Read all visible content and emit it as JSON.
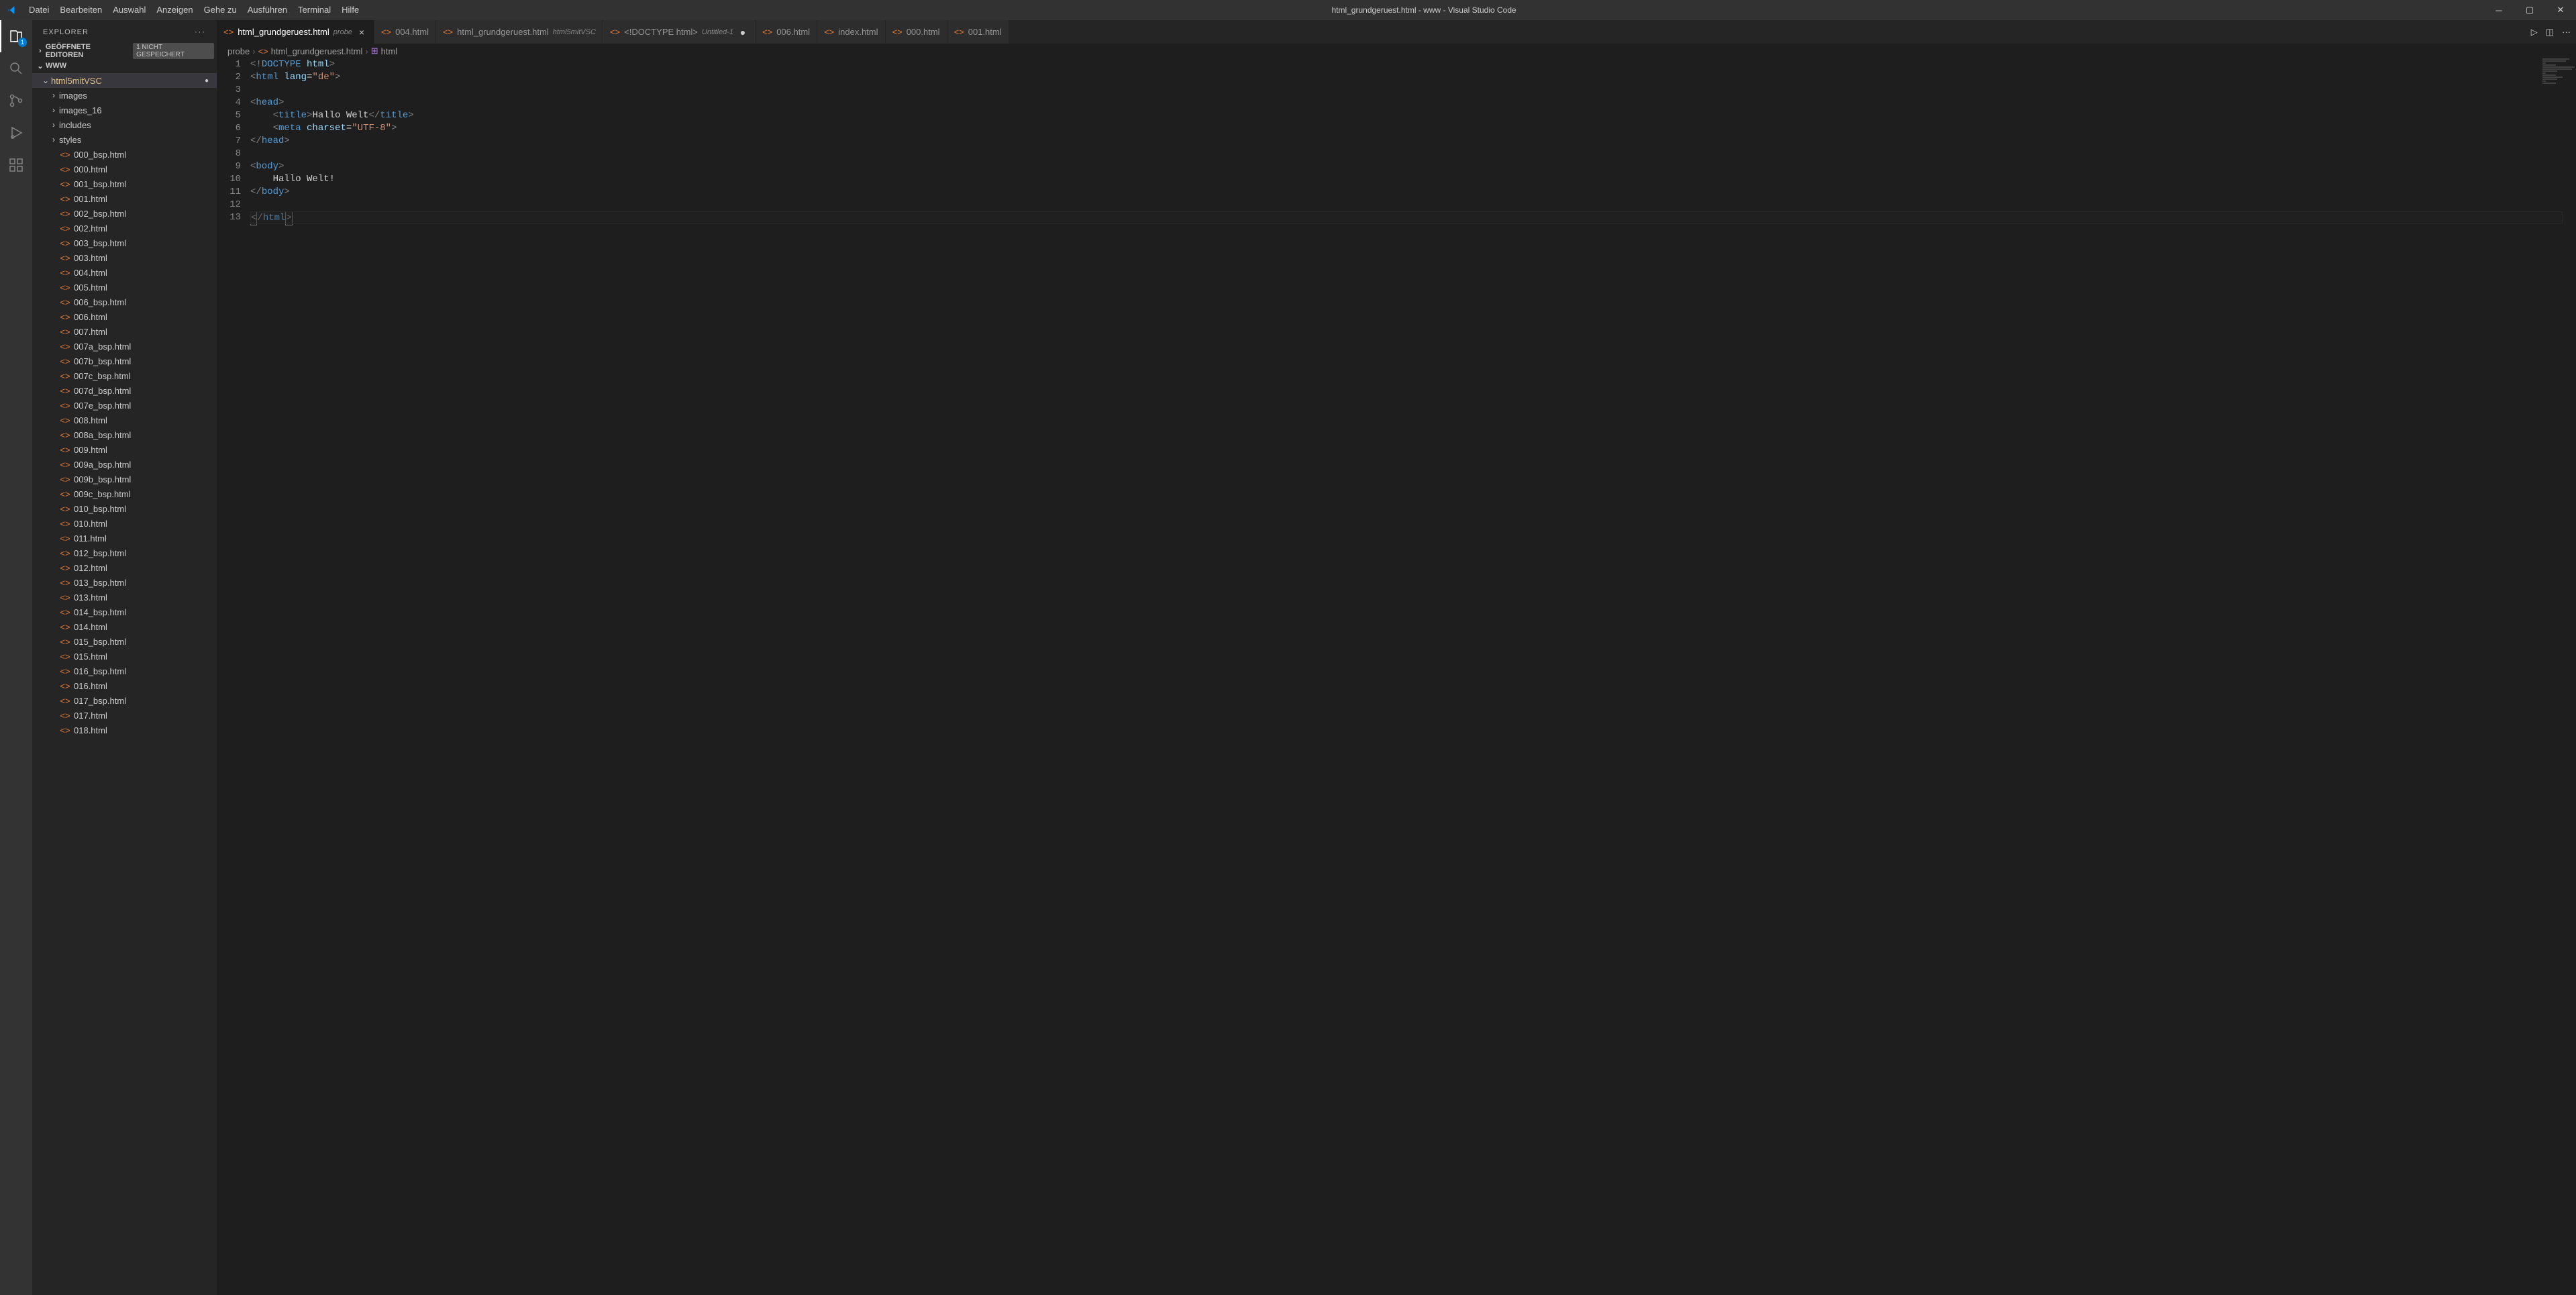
{
  "title": "html_grundgeruest.html - www - Visual Studio Code",
  "menu": [
    "Datei",
    "Bearbeiten",
    "Auswahl",
    "Anzeigen",
    "Gehe zu",
    "Ausführen",
    "Terminal",
    "Hilfe"
  ],
  "activity_badge": "1",
  "sidebar": {
    "title": "EXPLORER",
    "open_editors_label": "GEÖFFNETE EDITOREN",
    "open_editors_badge": "1 NICHT GESPEICHERT",
    "root": "www",
    "active_folder": "html5mitVSC",
    "folders": [
      "images",
      "images_16",
      "includes",
      "styles"
    ],
    "files": [
      "000_bsp.html",
      "000.html",
      "001_bsp.html",
      "001.html",
      "002_bsp.html",
      "002.html",
      "003_bsp.html",
      "003.html",
      "004.html",
      "005.html",
      "006_bsp.html",
      "006.html",
      "007.html",
      "007a_bsp.html",
      "007b_bsp.html",
      "007c_bsp.html",
      "007d_bsp.html",
      "007e_bsp.html",
      "008.html",
      "008a_bsp.html",
      "009.html",
      "009a_bsp.html",
      "009b_bsp.html",
      "009c_bsp.html",
      "010_bsp.html",
      "010.html",
      "011.html",
      "012_bsp.html",
      "012.html",
      "013_bsp.html",
      "013.html",
      "014_bsp.html",
      "014.html",
      "015_bsp.html",
      "015.html",
      "016_bsp.html",
      "016.html",
      "017_bsp.html",
      "017.html",
      "018.html"
    ]
  },
  "tabs": [
    {
      "label": "html_grundgeruest.html",
      "sub": "probe",
      "active": true,
      "close": true
    },
    {
      "label": "004.html"
    },
    {
      "label": "html_grundgeruest.html",
      "sub": "html5mitVSC"
    },
    {
      "label": "<!DOCTYPE html>",
      "sub": "Untitled-1",
      "dirty": true
    },
    {
      "label": "006.html"
    },
    {
      "label": "index.html"
    },
    {
      "label": "000.html"
    },
    {
      "label": "001.html"
    }
  ],
  "breadcrumbs": {
    "path": [
      "probe",
      "html_grundgeruest.html"
    ],
    "symbol": "html"
  },
  "code": {
    "lines": 13,
    "current_line": 13,
    "l1": "<!DOCTYPE html>",
    "l2_tag": "html",
    "l2_attr": "lang",
    "l2_val": "\"de\"",
    "l4": "head",
    "l5_tag": "title",
    "l5_text": "Hallo Welt",
    "l6_tag": "meta",
    "l6_attr": "charset",
    "l6_val": "\"UTF-8\"",
    "l7": "head",
    "l9": "body",
    "l10": "Hallo Welt!",
    "l11": "body",
    "l13": "html"
  }
}
